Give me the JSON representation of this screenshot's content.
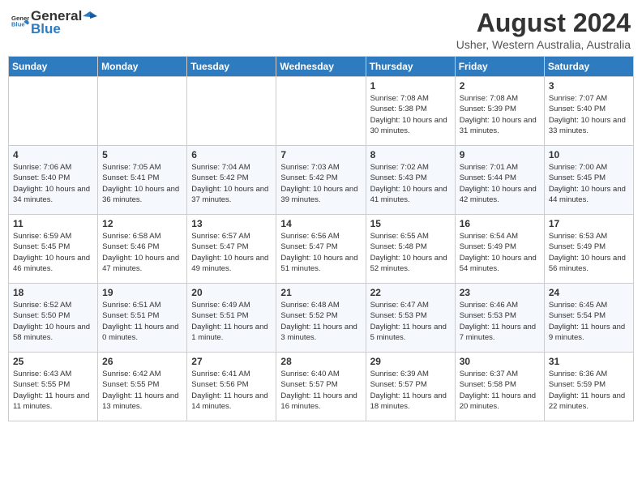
{
  "header": {
    "logo_general": "General",
    "logo_blue": "Blue",
    "month_year": "August 2024",
    "location": "Usher, Western Australia, Australia"
  },
  "days_of_week": [
    "Sunday",
    "Monday",
    "Tuesday",
    "Wednesday",
    "Thursday",
    "Friday",
    "Saturday"
  ],
  "weeks": [
    [
      {
        "day": "",
        "sunrise": "",
        "sunset": "",
        "daylight": ""
      },
      {
        "day": "",
        "sunrise": "",
        "sunset": "",
        "daylight": ""
      },
      {
        "day": "",
        "sunrise": "",
        "sunset": "",
        "daylight": ""
      },
      {
        "day": "",
        "sunrise": "",
        "sunset": "",
        "daylight": ""
      },
      {
        "day": "1",
        "sunrise": "7:08 AM",
        "sunset": "5:38 PM",
        "daylight": "10 hours and 30 minutes."
      },
      {
        "day": "2",
        "sunrise": "7:08 AM",
        "sunset": "5:39 PM",
        "daylight": "10 hours and 31 minutes."
      },
      {
        "day": "3",
        "sunrise": "7:07 AM",
        "sunset": "5:40 PM",
        "daylight": "10 hours and 33 minutes."
      }
    ],
    [
      {
        "day": "4",
        "sunrise": "7:06 AM",
        "sunset": "5:40 PM",
        "daylight": "10 hours and 34 minutes."
      },
      {
        "day": "5",
        "sunrise": "7:05 AM",
        "sunset": "5:41 PM",
        "daylight": "10 hours and 36 minutes."
      },
      {
        "day": "6",
        "sunrise": "7:04 AM",
        "sunset": "5:42 PM",
        "daylight": "10 hours and 37 minutes."
      },
      {
        "day": "7",
        "sunrise": "7:03 AM",
        "sunset": "5:42 PM",
        "daylight": "10 hours and 39 minutes."
      },
      {
        "day": "8",
        "sunrise": "7:02 AM",
        "sunset": "5:43 PM",
        "daylight": "10 hours and 41 minutes."
      },
      {
        "day": "9",
        "sunrise": "7:01 AM",
        "sunset": "5:44 PM",
        "daylight": "10 hours and 42 minutes."
      },
      {
        "day": "10",
        "sunrise": "7:00 AM",
        "sunset": "5:45 PM",
        "daylight": "10 hours and 44 minutes."
      }
    ],
    [
      {
        "day": "11",
        "sunrise": "6:59 AM",
        "sunset": "5:45 PM",
        "daylight": "10 hours and 46 minutes."
      },
      {
        "day": "12",
        "sunrise": "6:58 AM",
        "sunset": "5:46 PM",
        "daylight": "10 hours and 47 minutes."
      },
      {
        "day": "13",
        "sunrise": "6:57 AM",
        "sunset": "5:47 PM",
        "daylight": "10 hours and 49 minutes."
      },
      {
        "day": "14",
        "sunrise": "6:56 AM",
        "sunset": "5:47 PM",
        "daylight": "10 hours and 51 minutes."
      },
      {
        "day": "15",
        "sunrise": "6:55 AM",
        "sunset": "5:48 PM",
        "daylight": "10 hours and 52 minutes."
      },
      {
        "day": "16",
        "sunrise": "6:54 AM",
        "sunset": "5:49 PM",
        "daylight": "10 hours and 54 minutes."
      },
      {
        "day": "17",
        "sunrise": "6:53 AM",
        "sunset": "5:49 PM",
        "daylight": "10 hours and 56 minutes."
      }
    ],
    [
      {
        "day": "18",
        "sunrise": "6:52 AM",
        "sunset": "5:50 PM",
        "daylight": "10 hours and 58 minutes."
      },
      {
        "day": "19",
        "sunrise": "6:51 AM",
        "sunset": "5:51 PM",
        "daylight": "11 hours and 0 minutes."
      },
      {
        "day": "20",
        "sunrise": "6:49 AM",
        "sunset": "5:51 PM",
        "daylight": "11 hours and 1 minute."
      },
      {
        "day": "21",
        "sunrise": "6:48 AM",
        "sunset": "5:52 PM",
        "daylight": "11 hours and 3 minutes."
      },
      {
        "day": "22",
        "sunrise": "6:47 AM",
        "sunset": "5:53 PM",
        "daylight": "11 hours and 5 minutes."
      },
      {
        "day": "23",
        "sunrise": "6:46 AM",
        "sunset": "5:53 PM",
        "daylight": "11 hours and 7 minutes."
      },
      {
        "day": "24",
        "sunrise": "6:45 AM",
        "sunset": "5:54 PM",
        "daylight": "11 hours and 9 minutes."
      }
    ],
    [
      {
        "day": "25",
        "sunrise": "6:43 AM",
        "sunset": "5:55 PM",
        "daylight": "11 hours and 11 minutes."
      },
      {
        "day": "26",
        "sunrise": "6:42 AM",
        "sunset": "5:55 PM",
        "daylight": "11 hours and 13 minutes."
      },
      {
        "day": "27",
        "sunrise": "6:41 AM",
        "sunset": "5:56 PM",
        "daylight": "11 hours and 14 minutes."
      },
      {
        "day": "28",
        "sunrise": "6:40 AM",
        "sunset": "5:57 PM",
        "daylight": "11 hours and 16 minutes."
      },
      {
        "day": "29",
        "sunrise": "6:39 AM",
        "sunset": "5:57 PM",
        "daylight": "11 hours and 18 minutes."
      },
      {
        "day": "30",
        "sunrise": "6:37 AM",
        "sunset": "5:58 PM",
        "daylight": "11 hours and 20 minutes."
      },
      {
        "day": "31",
        "sunrise": "6:36 AM",
        "sunset": "5:59 PM",
        "daylight": "11 hours and 22 minutes."
      }
    ]
  ],
  "labels": {
    "sunrise": "Sunrise:",
    "sunset": "Sunset:",
    "daylight": "Daylight:"
  }
}
